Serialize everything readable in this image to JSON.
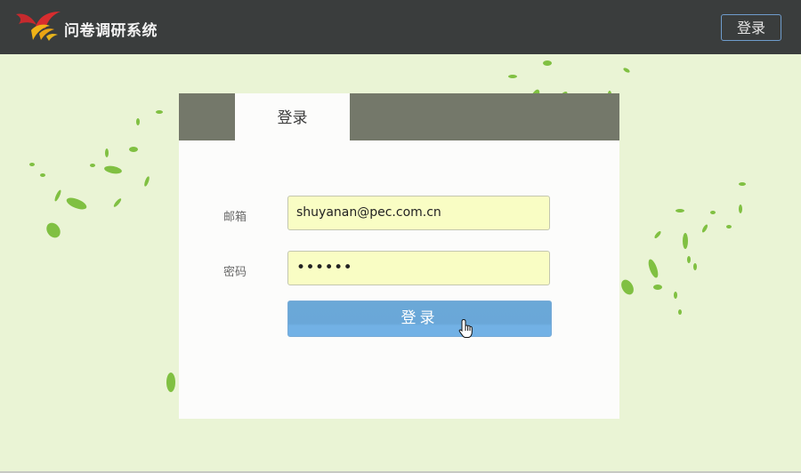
{
  "header": {
    "app_title": "问卷调研系统",
    "login_button_label": "登录",
    "logo_icon": "phoenix-logo-icon"
  },
  "login_card": {
    "tab_label": "登录",
    "email_label": "邮箱",
    "email_value": "shuyanan@pec.com.cn",
    "password_label": "密码",
    "password_value": "••••••",
    "submit_label": "登录"
  },
  "colors": {
    "topbar": "#3a3d3d",
    "page_background": "#eaf4d5",
    "card_header": "#74786a",
    "input_background": "#f9fdc4",
    "login_button": "#6aa7d8",
    "top_button_border": "#6f9ccc"
  },
  "icons": {
    "cursor": "hand-pointer-icon",
    "decoration": "leaf-icon"
  }
}
